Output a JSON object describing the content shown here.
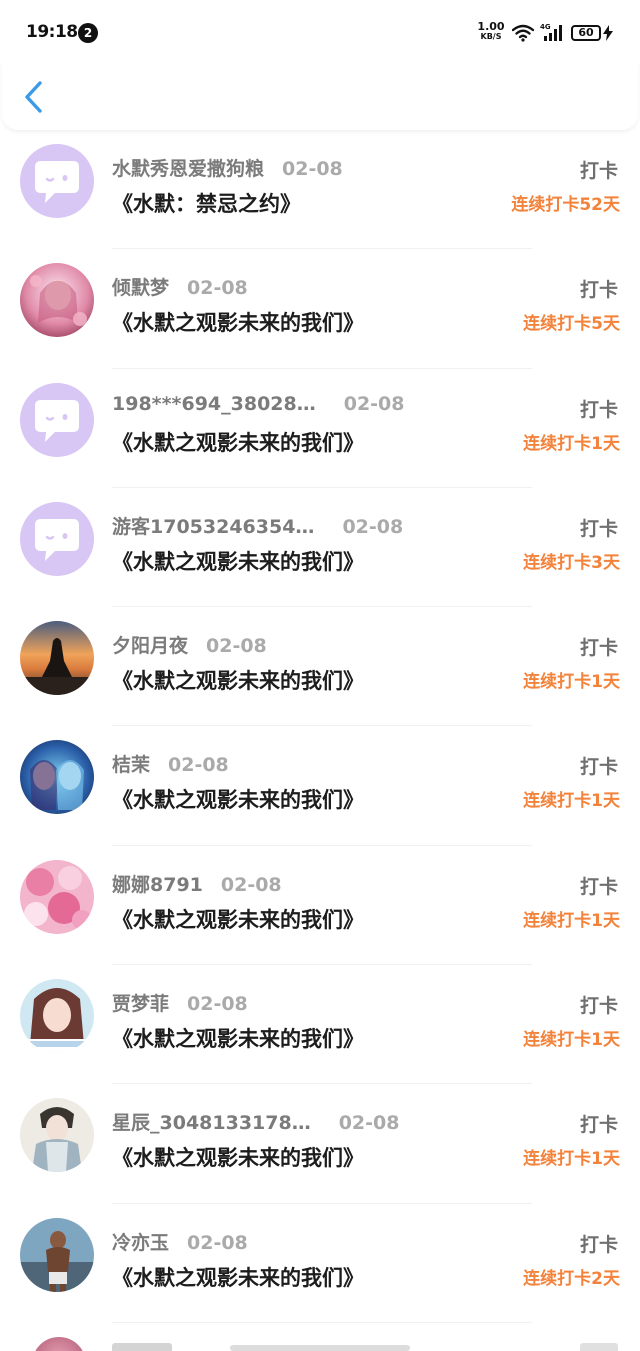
{
  "status_bar": {
    "time": "19:18",
    "notification_count": "2",
    "net_speed_value": "1.00",
    "net_speed_unit": "KB/S",
    "network_type": "4G",
    "battery_level": "60"
  },
  "nav": {
    "back_icon": "chevron-left-icon"
  },
  "colors": {
    "accent_blue": "#3a9ae8",
    "streak_orange": "#f3823a",
    "default_avatar_bg": "#d8c6f5"
  },
  "records": [
    {
      "user": "水默秀恩爱撒狗粮",
      "date": "02-08",
      "title": "《水默：禁忌之约》",
      "action": "打卡",
      "streak": "连续打卡52天",
      "avatar": "default"
    },
    {
      "user": "倾默梦",
      "date": "02-08",
      "title": "《水默之观影未来的我们》",
      "action": "打卡",
      "streak": "连续打卡5天",
      "avatar": "pink-anime"
    },
    {
      "user": "198***694_38028…",
      "date": "02-08",
      "title": "《水默之观影未来的我们》",
      "action": "打卡",
      "streak": "连续打卡1天",
      "avatar": "default"
    },
    {
      "user": "游客17053246354…",
      "date": "02-08",
      "title": "《水默之观影未来的我们》",
      "action": "打卡",
      "streak": "连续打卡3天",
      "avatar": "default"
    },
    {
      "user": "夕阳月夜",
      "date": "02-08",
      "title": "《水默之观影未来的我们》",
      "action": "打卡",
      "streak": "连续打卡1天",
      "avatar": "sunset"
    },
    {
      "user": "桔茉",
      "date": "02-08",
      "title": "《水默之观影未来的我们》",
      "action": "打卡",
      "streak": "连续打卡1天",
      "avatar": "blue-anime"
    },
    {
      "user": "娜娜8791",
      "date": "02-08",
      "title": "《水默之观影未来的我们》",
      "action": "打卡",
      "streak": "连续打卡1天",
      "avatar": "pink-flowers"
    },
    {
      "user": "贾梦菲",
      "date": "02-08",
      "title": "《水默之观影未来的我们》",
      "action": "打卡",
      "streak": "连续打卡1天",
      "avatar": "girl-photo"
    },
    {
      "user": "星辰_3048133178…",
      "date": "02-08",
      "title": "《水默之观影未来的我们》",
      "action": "打卡",
      "streak": "连续打卡1天",
      "avatar": "ancient-costume"
    },
    {
      "user": "冷亦玉",
      "date": "02-08",
      "title": "《水默之观影未来的我们》",
      "action": "打卡",
      "streak": "连续打卡2天",
      "avatar": "man-photo"
    }
  ]
}
